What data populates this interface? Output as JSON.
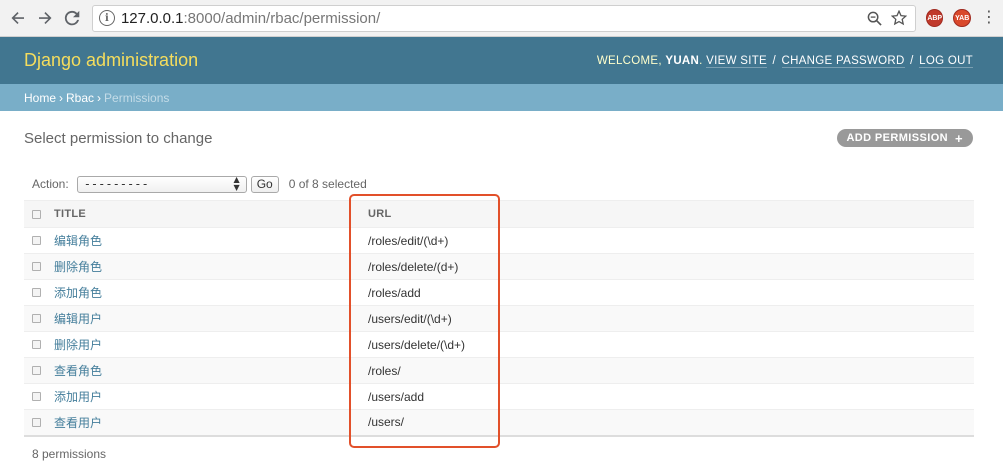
{
  "browser": {
    "url_host": "127.0.0.1",
    "url_rest": ":8000/admin/rbac/permission/",
    "ext_abp": "ABP",
    "ext_yab": "YAB"
  },
  "header": {
    "branding": "Django administration",
    "welcome": "Welcome,",
    "username": "yuan",
    "view_site": "View site",
    "change_password": "Change password",
    "log_out": "Log out",
    "sep": "/"
  },
  "breadcrumbs": {
    "home": "Home",
    "app": "Rbac",
    "current": "Permissions",
    "sep": "›"
  },
  "content": {
    "title": "Select permission to change",
    "add_button": "Add permission",
    "add_plus": "+"
  },
  "actions": {
    "label": "Action:",
    "selected_option": "---------",
    "go": "Go",
    "selection_count": "0 of 8 selected"
  },
  "table": {
    "columns": [
      "Title",
      "URL"
    ],
    "rows": [
      {
        "title": "编辑角色",
        "url": "/roles/edit/(\\d+)"
      },
      {
        "title": "删除角色",
        "url": "/roles/delete/(d+)"
      },
      {
        "title": "添加角色",
        "url": "/roles/add"
      },
      {
        "title": "编辑用户",
        "url": "/users/edit/(\\d+)"
      },
      {
        "title": "删除用户",
        "url": "/users/delete/(\\d+)"
      },
      {
        "title": "查看角色",
        "url": "/roles/"
      },
      {
        "title": "添加用户",
        "url": "/users/add"
      },
      {
        "title": "查看用户",
        "url": "/users/"
      }
    ]
  },
  "paginator": "8 permissions",
  "colors": {
    "header_bg": "#417690",
    "branding": "#f5dd5d",
    "breadcrumbs_bg": "#79aec8",
    "link": "#447e9b",
    "highlight": "#e2502a"
  }
}
